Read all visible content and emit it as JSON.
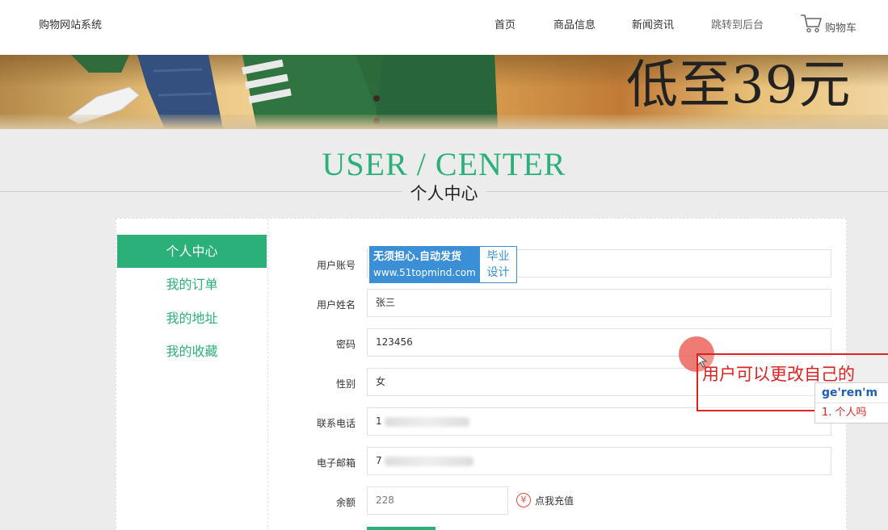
{
  "header": {
    "brand": "购物网站系统",
    "nav": [
      "首页",
      "商品信息",
      "新闻资讯",
      "跳转到后台"
    ],
    "cart_label": "购物车"
  },
  "banner": {
    "text": "低至39元"
  },
  "title": {
    "en": "USER / CENTER",
    "cn": "个人中心"
  },
  "sidebar": {
    "items": [
      "个人中心",
      "我的订单",
      "我的地址",
      "我的收藏"
    ]
  },
  "form": {
    "labels": {
      "account": "用户账号",
      "name": "用户姓名",
      "password": "密码",
      "gender": "性别",
      "phone": "联系电话",
      "email": "电子邮箱",
      "balance": "余额"
    },
    "values": {
      "name": "张三",
      "password": "123456",
      "gender": "女",
      "phone_prefix": "1",
      "email_prefix": "7",
      "balance": "228"
    },
    "recharge_icon": "¥",
    "recharge_label": "点我充值"
  },
  "watermark": {
    "line1": "无须担心.自动发货",
    "line2": "www.51topmind.com",
    "right1": "毕业",
    "right2": "设计"
  },
  "annotation": {
    "text": "用户可以更改自己的",
    "ime_input": "ge'ren'm",
    "ime_candidate": "1. 个人吗"
  },
  "colors": {
    "accent": "#2cb07a",
    "annotation": "#dd2222",
    "watermark": "#3a8fd6"
  }
}
